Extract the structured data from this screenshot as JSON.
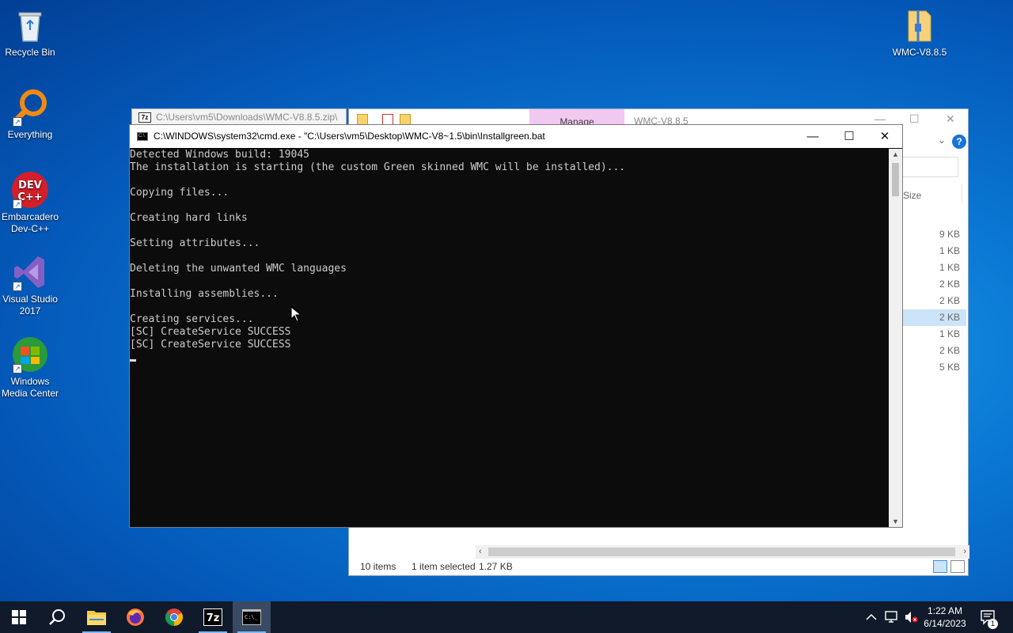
{
  "desktop": {
    "icons": [
      {
        "label": "Recycle Bin"
      },
      {
        "label": "Everything"
      },
      {
        "label": "Embarcadero Dev-C++"
      },
      {
        "label": "Visual Studio 2017"
      },
      {
        "label": "Windows Media Center"
      },
      {
        "label": "WMC-V8.8.5"
      }
    ]
  },
  "zip_window": {
    "title": "C:\\Users\\vm5\\Downloads\\WMC-V8.8.5.zip\\",
    "icon": "7z"
  },
  "explorer": {
    "manage_tab": "Manage",
    "title": "WMC-V8.8.5",
    "column_size": "Size",
    "sizes": [
      "9 KB",
      "1 KB",
      "1 KB",
      "2 KB",
      "2 KB",
      "2 KB",
      "1 KB",
      "2 KB",
      "5 KB"
    ],
    "selected_row": 5,
    "status": {
      "items": "10 items",
      "selected": "1 item selected",
      "size": "1.27 KB"
    }
  },
  "cmd": {
    "title": "C:\\WINDOWS\\system32\\cmd.exe - \"C:\\Users\\vm5\\Desktop\\WMC-V8~1.5\\bin\\Installgreen.bat",
    "lines": [
      "Detected Windows build: 19045",
      "The installation is starting (the custom Green skinned WMC will be installed)...",
      "",
      "Copying files...",
      "",
      "Creating hard links",
      "",
      "Setting attributes...",
      "",
      "Deleting the unwanted WMC languages",
      "",
      "Installing assemblies...",
      "",
      "Creating services...",
      "[SC] CreateService SUCCESS",
      "[SC] CreateService SUCCESS"
    ]
  },
  "taskbar": {
    "apps": [
      "start-icon",
      "search-icon",
      "file-explorer-icon",
      "firefox-icon",
      "chrome-icon",
      "7zip-icon",
      "cmd-icon"
    ],
    "clock": {
      "time": "1:22 AM",
      "date": "6/14/2023"
    },
    "notification_count": "1"
  }
}
